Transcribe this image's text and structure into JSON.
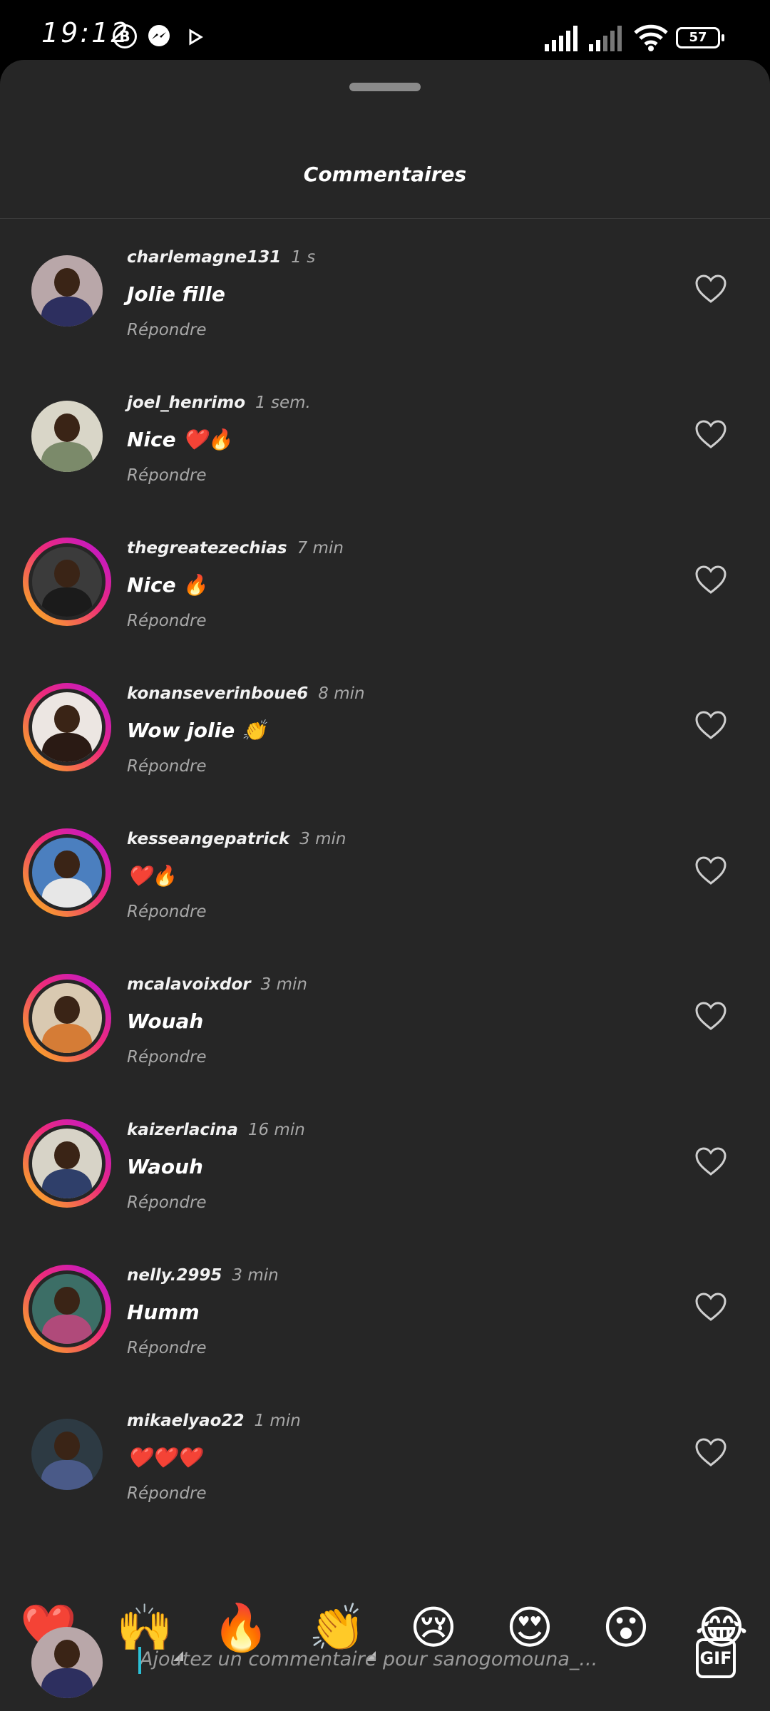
{
  "status_bar": {
    "time": "19:12",
    "icons": [
      "b-circle-icon",
      "messenger-icon",
      "play-icon"
    ],
    "battery": "57"
  },
  "sheet": {
    "title": "Commentaires"
  },
  "comments": [
    {
      "username": "charlemagne131",
      "time": "1 s",
      "text": "Jolie fille",
      "reply": "Répondre",
      "story": false,
      "avatar_bg": "#b9a7a9",
      "avatar_body": "#2d2f5f"
    },
    {
      "username": "joel_henrimo",
      "time": "1 sem.",
      "text": "Nice ❤️🔥",
      "reply": "Répondre",
      "story": false,
      "avatar_bg": "#d9d6c8",
      "avatar_body": "#7b8a6a"
    },
    {
      "username": "thegreatezechias",
      "time": "7 min",
      "text": "Nice 🔥",
      "reply": "Répondre",
      "story": true,
      "avatar_bg": "#3b3b3b",
      "avatar_body": "#1b1b1b"
    },
    {
      "username": "konanseverinboue6",
      "time": "8 min",
      "text": "Wow jolie 👏",
      "reply": "Répondre",
      "story": true,
      "avatar_bg": "#ece6e2",
      "avatar_body": "#2a1a14"
    },
    {
      "username": "kesseangepatrick",
      "time": "3 min",
      "text": "❤️🔥",
      "reply": "Répondre",
      "story": true,
      "avatar_bg": "#4b7fbf",
      "avatar_body": "#e7e7e7"
    },
    {
      "username": "mcalavoixdor",
      "time": "3 min",
      "text": "Wouah",
      "reply": "Répondre",
      "story": true,
      "avatar_bg": "#d9c9b1",
      "avatar_body": "#d57c36"
    },
    {
      "username": "kaizerlacina",
      "time": "16 min",
      "text": "Waouh",
      "reply": "Répondre",
      "story": true,
      "avatar_bg": "#d7d3c7",
      "avatar_body": "#2f3f6a"
    },
    {
      "username": "nelly.2995",
      "time": "3 min",
      "text": "Humm",
      "reply": "Répondre",
      "story": true,
      "avatar_bg": "#3c6e66",
      "avatar_body": "#b04a7a"
    },
    {
      "username": "mikaelyao22",
      "time": "1 min",
      "text": "❤️❤️❤️",
      "reply": "Répondre",
      "story": false,
      "avatar_bg": "#2d3a43",
      "avatar_body": "#4a5a88"
    }
  ],
  "quick_reactions": [
    "❤️",
    "🙌",
    "🔥",
    "👏",
    "😢",
    "😍",
    "😮",
    "😂"
  ],
  "input": {
    "placeholder": "Ajoutez un commentaire pour sanogomouna_...",
    "gif_label": "GIF"
  },
  "colors": {
    "sheet_bg": "#262626",
    "muted": "#a8a8a8",
    "story_ring": "#ee2a7b"
  }
}
